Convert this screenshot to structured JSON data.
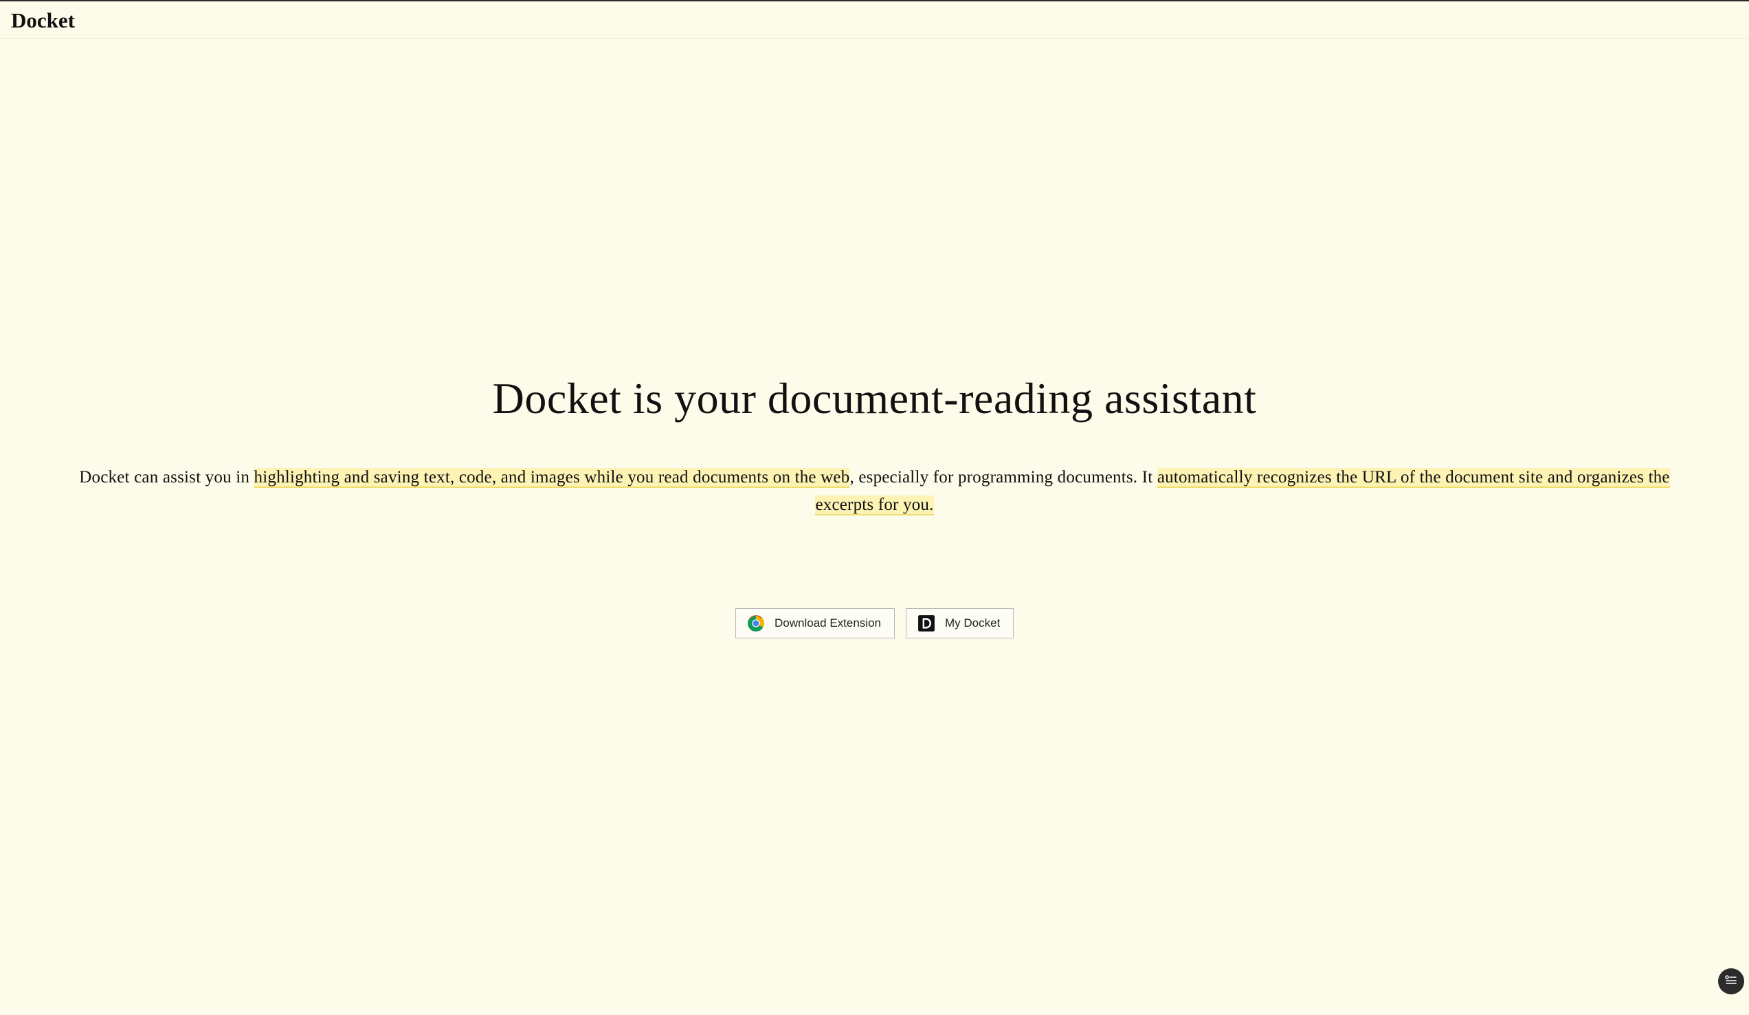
{
  "header": {
    "brand": "Docket"
  },
  "hero": {
    "title": "Docket is your document-reading assistant",
    "desc_part1": "Docket can assist you in ",
    "desc_highlight1": "highlighting and saving text, code, and images while you read documents on the web",
    "desc_part2": ", especially for programming documents. It ",
    "desc_highlight2": "automatically recognizes the URL of the document site and organizes the excerpts for you."
  },
  "actions": {
    "download_label": "Download Extension",
    "download_icon": "chrome-icon",
    "mydocket_label": "My Docket",
    "mydocket_icon": "docket-logo-icon"
  },
  "floating": {
    "icon": "list-menu-icon"
  },
  "colors": {
    "background": "#fdfbe9",
    "highlight": "#fdf3b4",
    "highlight_underline": "#f0dc6a",
    "fab": "#2b2b2b"
  }
}
